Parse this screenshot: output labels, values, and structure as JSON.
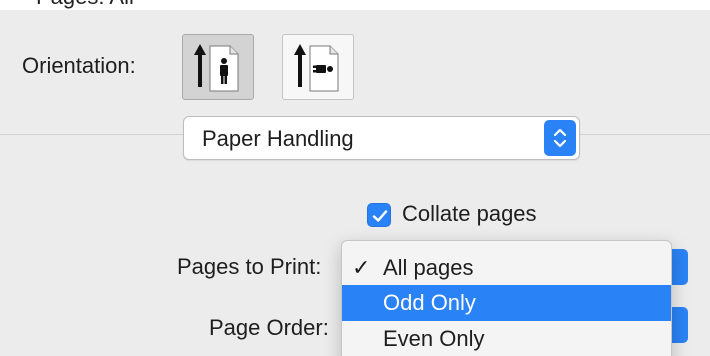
{
  "top_heading": "Pages: All",
  "orientation": {
    "label": "Orientation:",
    "options": [
      "portrait",
      "landscape"
    ],
    "selected": "portrait"
  },
  "section_popup": {
    "value": "Paper Handling"
  },
  "collate": {
    "label": "Collate pages",
    "checked": true
  },
  "pages_to_print": {
    "label": "Pages to Print:",
    "menu": {
      "items": [
        {
          "label": "All pages",
          "checked": true,
          "highlighted": false
        },
        {
          "label": "Odd Only",
          "checked": false,
          "highlighted": true
        },
        {
          "label": "Even Only",
          "checked": false,
          "highlighted": false
        }
      ],
      "check_glyph": "✓"
    }
  },
  "page_order": {
    "label": "Page Order:"
  },
  "colors": {
    "accent": "#2a83f6",
    "background": "#ececec"
  }
}
